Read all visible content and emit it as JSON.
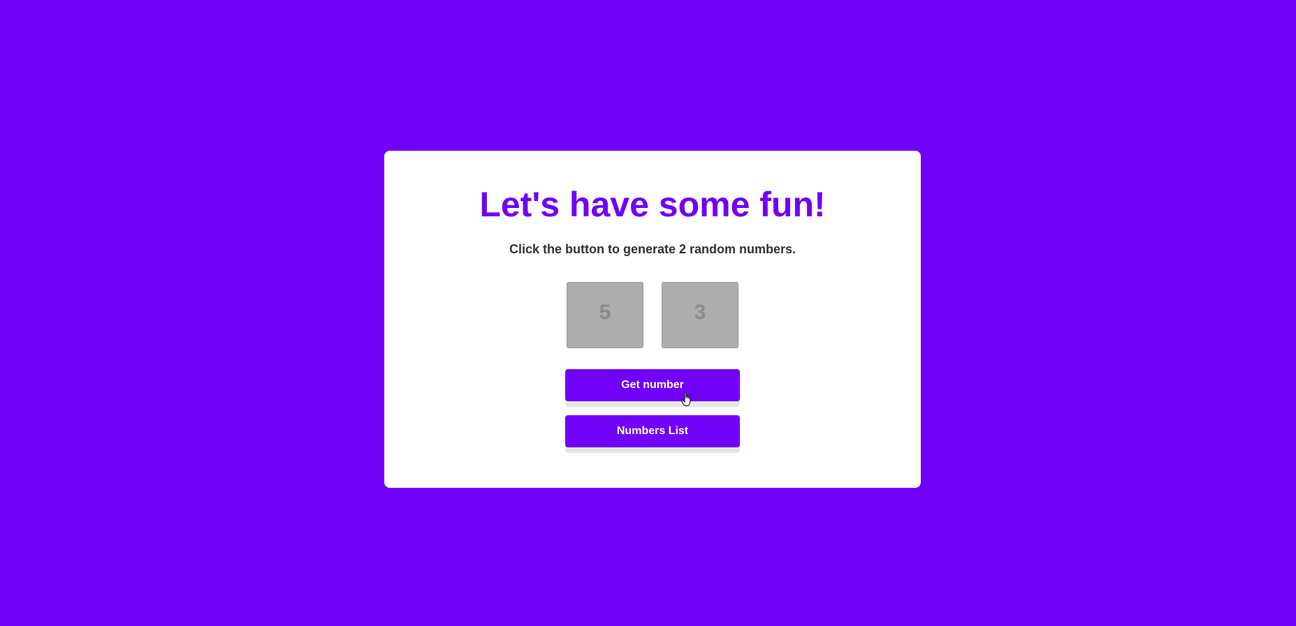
{
  "page": {
    "title": "Let's have some fun!",
    "subtitle": "Click the button to generate 2 random numbers."
  },
  "numbers": [
    "5",
    "3"
  ],
  "buttons": {
    "get_number": "Get number",
    "numbers_list": "Numbers List"
  },
  "colors": {
    "background": "#7000f7",
    "accent": "#7000f7",
    "card": "#ffffff",
    "number_box": "#adadad"
  },
  "icons": {
    "cursor": "hand-pointer-icon"
  }
}
